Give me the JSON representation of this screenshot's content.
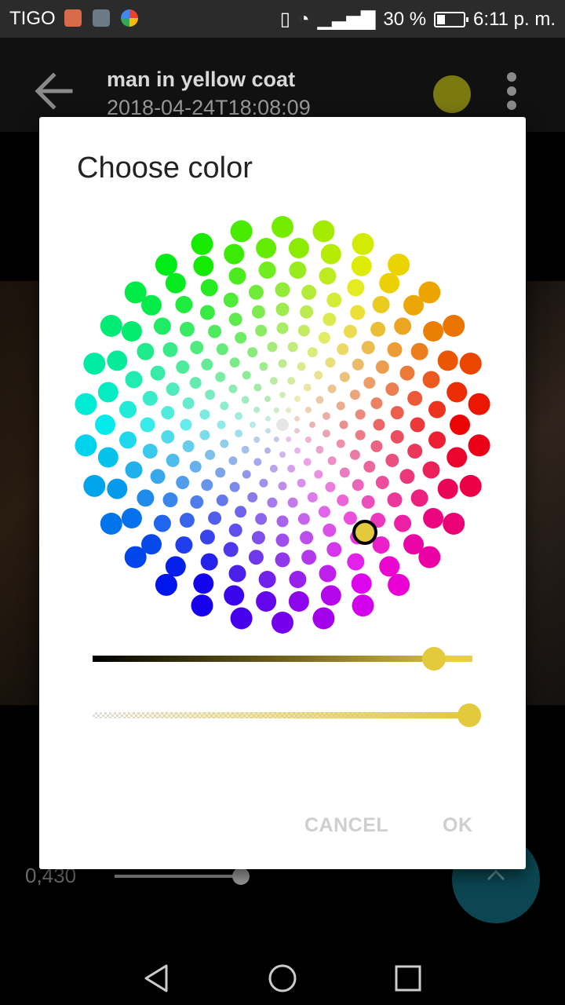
{
  "status_bar": {
    "carrier": "TIGO",
    "battery_percent": "30 %",
    "time": "6:11 p. m."
  },
  "app_bar": {
    "title": "man in yellow coat",
    "subtitle": "2018-04-24T18:08:09",
    "current_color": "#7a7a10"
  },
  "background": {
    "slider_value_label": "0,430",
    "slider_fraction": 0.43
  },
  "dialog": {
    "title": "Choose color",
    "selected_color": "#e3c93c",
    "lightness_fraction": 0.9,
    "alpha_fraction": 1.0,
    "cancel_label": "CANCEL",
    "ok_label": "OK"
  },
  "icons": {
    "back": "arrow-left-icon",
    "menu": "more-vert-icon",
    "fab": "chevron-up-icon",
    "nav_back": "triangle-back-icon",
    "nav_home": "circle-home-icon",
    "nav_recents": "square-recents-icon"
  }
}
